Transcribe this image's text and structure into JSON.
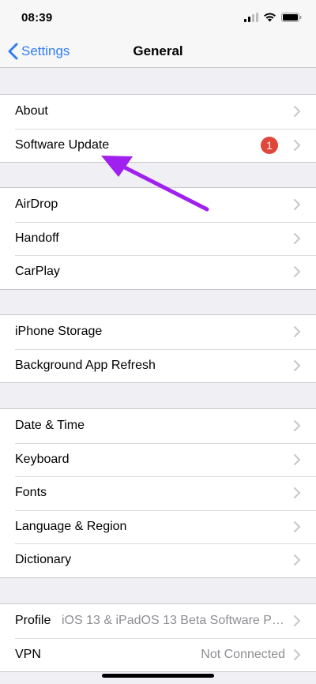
{
  "status_bar": {
    "time": "08:39"
  },
  "nav": {
    "back_label": "Settings",
    "title": "General"
  },
  "groups": [
    {
      "rows": [
        {
          "label": "About"
        },
        {
          "label": "Software Update",
          "badge": "1"
        }
      ]
    },
    {
      "rows": [
        {
          "label": "AirDrop"
        },
        {
          "label": "Handoff"
        },
        {
          "label": "CarPlay"
        }
      ]
    },
    {
      "rows": [
        {
          "label": "iPhone Storage"
        },
        {
          "label": "Background App Refresh"
        }
      ]
    },
    {
      "rows": [
        {
          "label": "Date & Time"
        },
        {
          "label": "Keyboard"
        },
        {
          "label": "Fonts"
        },
        {
          "label": "Language & Region"
        },
        {
          "label": "Dictionary"
        }
      ]
    },
    {
      "rows": [
        {
          "label": "Profile",
          "value": "iOS 13 & iPadOS 13 Beta Software Pr..."
        },
        {
          "label": "VPN",
          "value": "Not Connected"
        }
      ]
    }
  ],
  "colors": {
    "accent": "#2f7cf6",
    "badge": "#e0463a",
    "annotation_arrow": "#a020f0",
    "background": "#efeff4"
  },
  "icons": [
    "signal-icon",
    "wifi-icon",
    "battery-icon",
    "chevron-left-icon",
    "chevron-right-icon"
  ]
}
